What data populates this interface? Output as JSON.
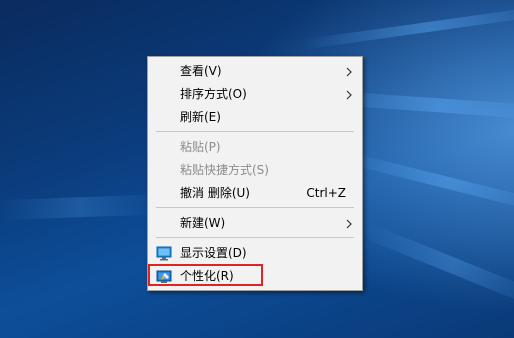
{
  "context_menu": {
    "items": [
      {
        "label": "查看(V)",
        "has_submenu": true,
        "enabled": true
      },
      {
        "label": "排序方式(O)",
        "has_submenu": true,
        "enabled": true
      },
      {
        "label": "刷新(E)",
        "has_submenu": false,
        "enabled": true
      },
      {
        "label": "粘贴(P)",
        "has_submenu": false,
        "enabled": false
      },
      {
        "label": "粘贴快捷方式(S)",
        "has_submenu": false,
        "enabled": false
      },
      {
        "label": "撤消 删除(U)",
        "shortcut": "Ctrl+Z",
        "has_submenu": false,
        "enabled": true
      },
      {
        "label": "新建(W)",
        "has_submenu": true,
        "enabled": true
      },
      {
        "label": "显示设置(D)",
        "icon": "display-icon",
        "has_submenu": false,
        "enabled": true
      },
      {
        "label": "个性化(R)",
        "icon": "personalize-icon",
        "has_submenu": false,
        "enabled": true,
        "highlighted": true
      }
    ]
  },
  "colors": {
    "menu_background": "#f2f2f2",
    "highlight_border": "#e02424",
    "disabled_text": "#8c8c8c",
    "desktop_blue": "#0b3c7c"
  }
}
